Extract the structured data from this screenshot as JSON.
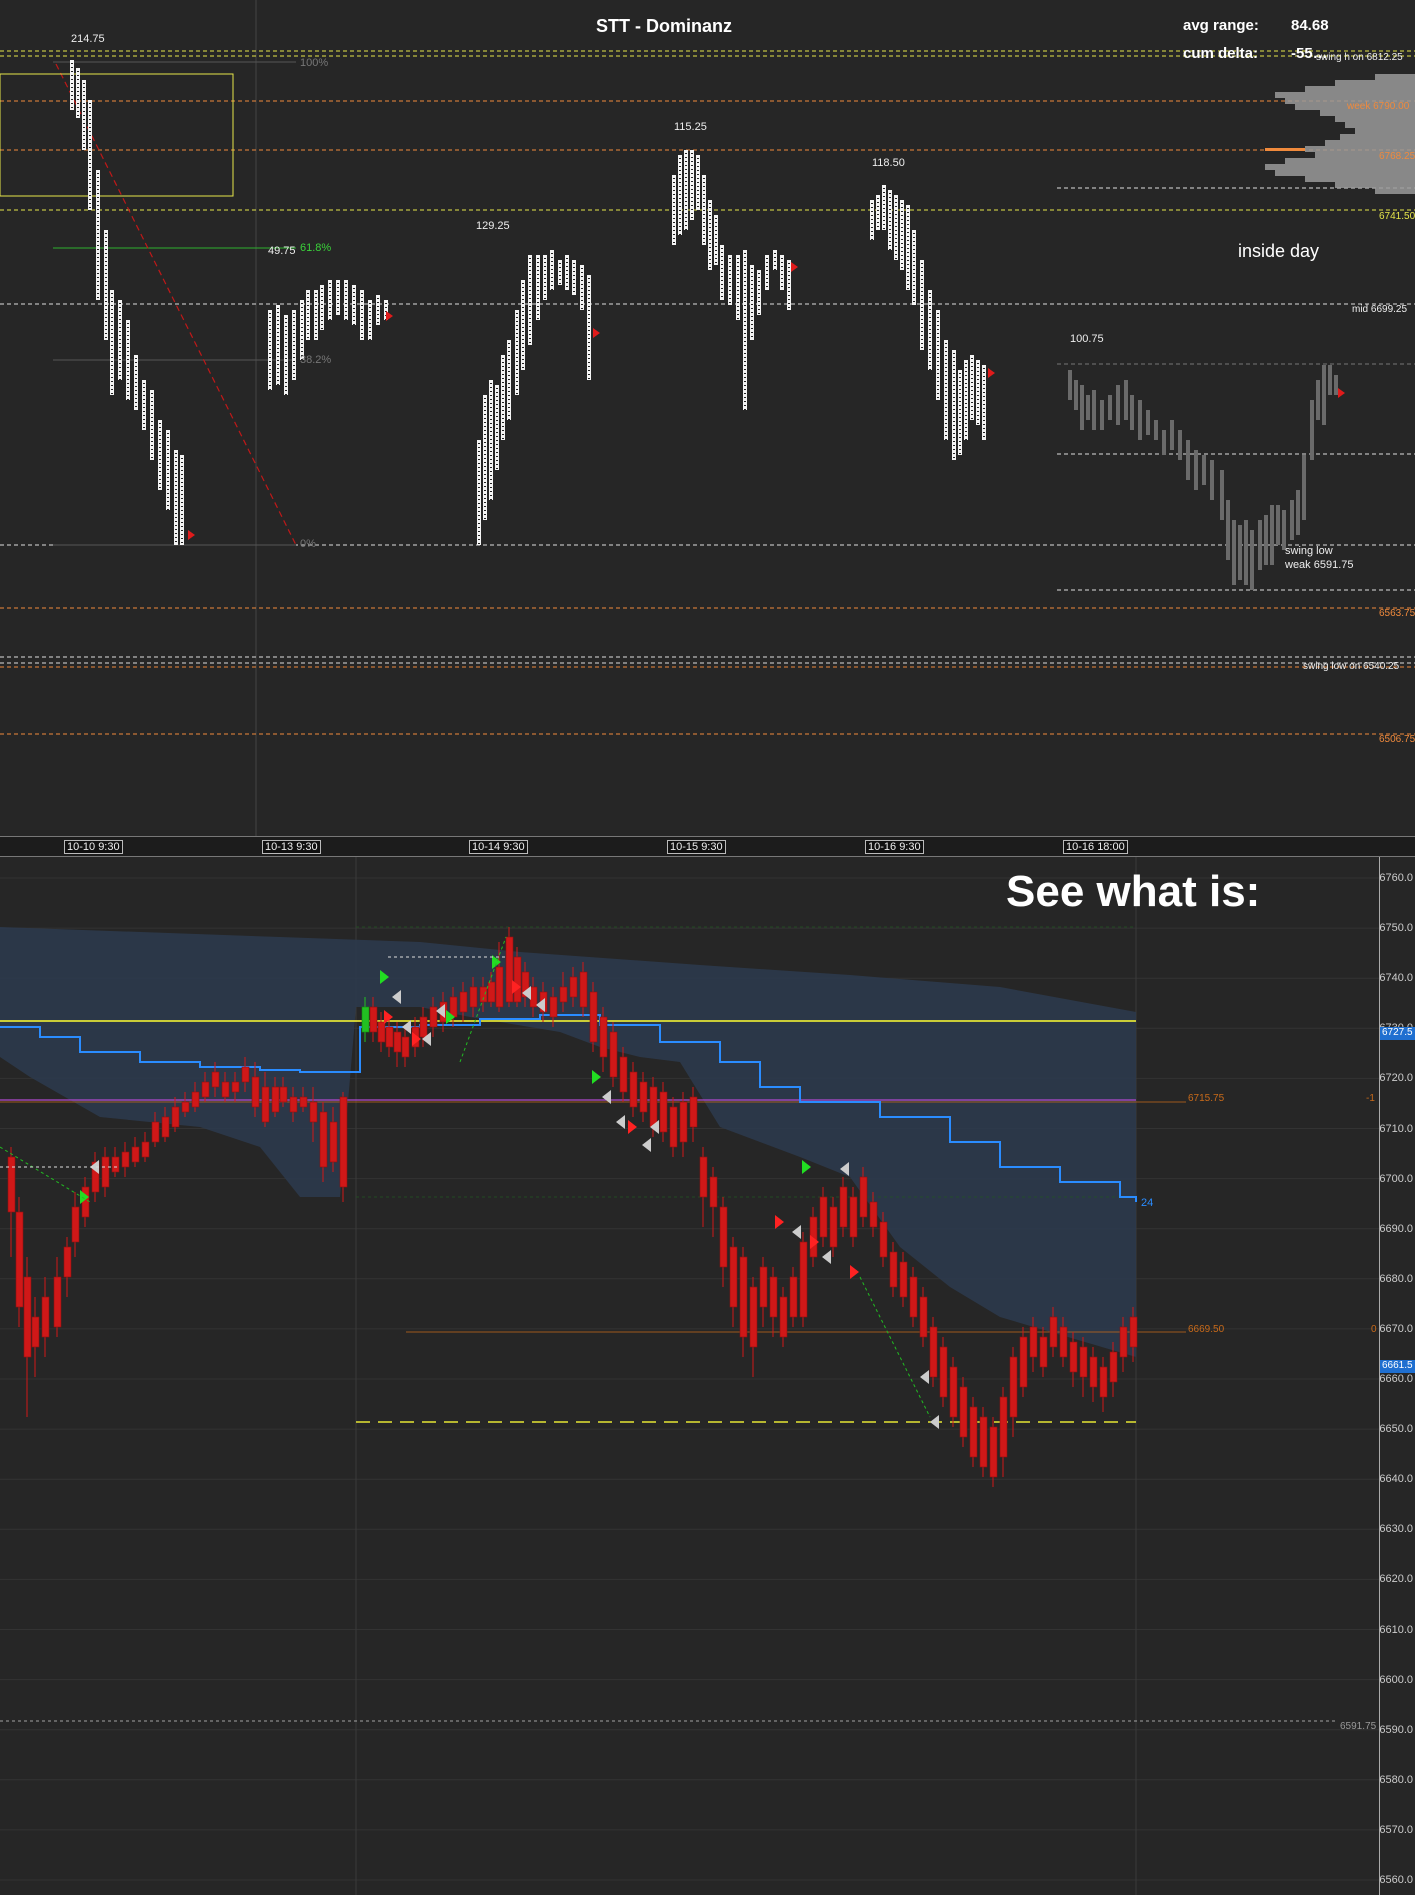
{
  "header": {
    "title": "STT - Dominanz",
    "avg_range_label": "avg range:",
    "avg_range_value": "84.68",
    "cum_delta_label": "cum delta:",
    "cum_delta_value": "-55…"
  },
  "top_chart": {
    "range_labels": [
      "214.75",
      "115.25",
      "118.50",
      "129.25",
      "49.75",
      "100.75"
    ],
    "fib_labels": [
      "100%",
      "61.8%",
      "38.2%",
      "0%"
    ],
    "annotations": {
      "inside_day": "inside day",
      "swing_low_weak_1": "swing low",
      "swing_low_weak_2": "weak  6591.75"
    },
    "level_labels": {
      "swing_high_on": "swing h on  6812.25",
      "week_high": "week  6790.00",
      "level_6768": "6768.25",
      "level_6741": "6741.50",
      "mid": "mid  6699.25",
      "level_6563": "6563.75",
      "swing_low_on": "swing low on  6540.25",
      "level_6506": "6506.75"
    }
  },
  "time_axis": {
    "labels": [
      "10-10  9:30",
      "10-13  9:30",
      "10-14  9:30",
      "10-15  9:30",
      "10-16  9:30",
      "10-16  18:00"
    ]
  },
  "bottom_chart": {
    "overlay_text": "See what is:",
    "price_ticks": [
      "6760.0",
      "6750.0",
      "6740.0",
      "6730.0",
      "6720.0",
      "6710.0",
      "6700.0",
      "6690.0",
      "6680.0",
      "6670.0",
      "6660.0",
      "6650.0",
      "6640.0",
      "6630.0",
      "6620.0",
      "6610.0",
      "6600.0",
      "6590.0",
      "6580.0",
      "6570.0",
      "6560.0"
    ],
    "level_labels": {
      "purple_line": "6715.75",
      "purple_right": "-1",
      "orange_line": "6669.50",
      "orange_right": "0",
      "blue_value": "24",
      "low_line": "6591.75"
    },
    "axis_markers": {
      "current_blue": "6727.5",
      "current_price": "6661.5"
    },
    "colors": {
      "up": "#22c022",
      "down": "#d01818",
      "vwap": "#2a8cff",
      "value_area": "#2c3a4c",
      "yellow_level": "#ffff33",
      "purple_level": "#b04ad0",
      "orange_level": "#c86a1a"
    }
  }
}
